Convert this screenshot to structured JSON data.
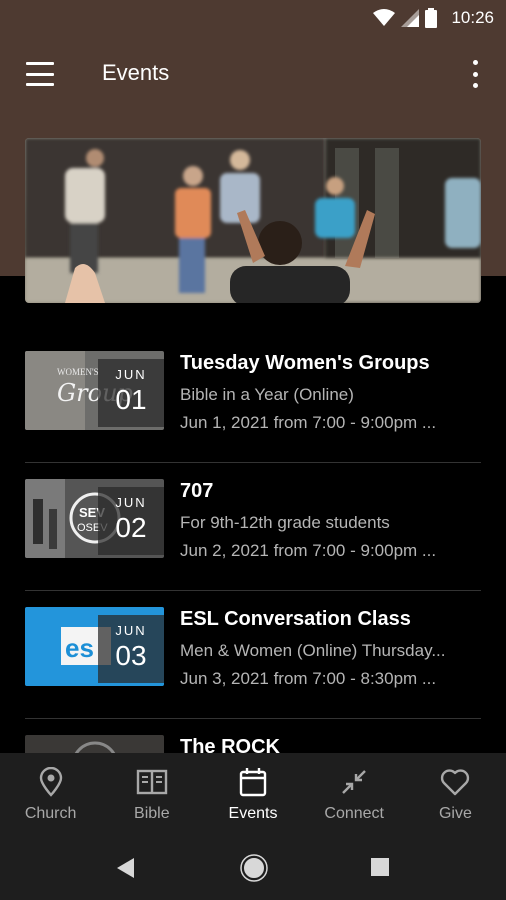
{
  "status_bar": {
    "time": "10:26"
  },
  "app_bar": {
    "title": "Events"
  },
  "events": [
    {
      "month": "JUN",
      "day": "01",
      "title": "Tuesday Women's Groups",
      "subtitle": "Bible in a Year (Online)",
      "when": "Jun 1, 2021 from 7:00 - 9:00pm ..."
    },
    {
      "month": "JUN",
      "day": "02",
      "title": "707",
      "subtitle": "For 9th-12th grade students",
      "when": "Jun 2, 2021 from 7:00 - 9:00pm ..."
    },
    {
      "month": "JUN",
      "day": "03",
      "title": "ESL Conversation Class",
      "subtitle": "Men & Women (Online) Thursday...",
      "when": "Jun 3, 2021 from 7:00 - 8:30pm ..."
    },
    {
      "title": "The ROCK"
    }
  ],
  "bottom_nav": [
    {
      "label": "Church",
      "icon": "location-pin-icon"
    },
    {
      "label": "Bible",
      "icon": "book-icon"
    },
    {
      "label": "Events",
      "icon": "calendar-icon",
      "active": true
    },
    {
      "label": "Connect",
      "icon": "connect-arrows-icon"
    },
    {
      "label": "Give",
      "icon": "heart-icon"
    }
  ],
  "colors": {
    "header_brown": "#4e3a31",
    "background": "#000000",
    "nav_background": "#1e1e1e",
    "muted_text": "#b5b5b5",
    "esl_blue": "#1c8fd6"
  }
}
